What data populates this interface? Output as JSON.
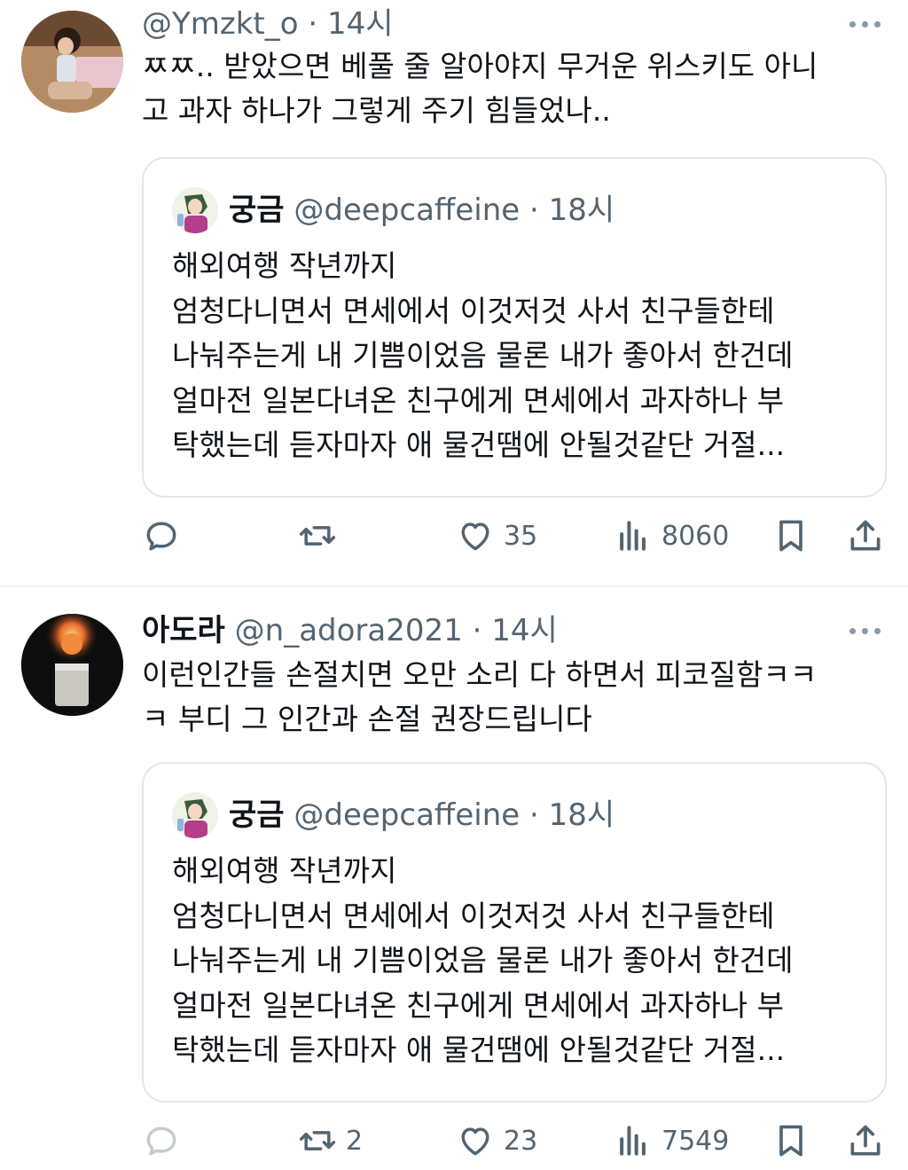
{
  "tweets": [
    {
      "name": "",
      "handle": "@Ymzkt_o",
      "dot": "·",
      "time": "14시",
      "text": "ㅉㅉ.. 받았으면 베풀 줄 알아야지 무거운 위스키도 아니\n고 과자 하나가 그렇게 주기 힘들었나..",
      "quote": {
        "name": "궁금",
        "handle": "@deepcaffeine",
        "dot": "·",
        "time": "18시",
        "text": "해외여행 작년까지\n엄청다니면서 면세에서 이것저것 사서 친구들한테\n나눠주는게 내 기쁨이었음 물론 내가 좋아서 한건데\n얼마전 일본다녀온 친구에게 면세에서 과자하나 부\n탁했는데 듣자마자 애 물건땜에 안될것같단 거절..."
      },
      "actions": {
        "reply": "",
        "retweet": "",
        "like": "35",
        "views": "8060"
      }
    },
    {
      "name": "아도라",
      "handle": "@n_adora2021",
      "dot": "·",
      "time": "14시",
      "text": "이런인간들 손절치면 오만 소리 다 하면서 피코질함ㅋㅋ\nㅋ 부디 그 인간과 손절 권장드립니다",
      "quote": {
        "name": "궁금",
        "handle": "@deepcaffeine",
        "dot": "·",
        "time": "18시",
        "text": "해외여행 작년까지\n엄청다니면서 면세에서 이것저것 사서 친구들한테\n나눠주는게 내 기쁨이었음 물론 내가 좋아서 한건데\n얼마전 일본다녀온 친구에게 면세에서 과자하나 부\n탁했는데 듣자마자 애 물건땜에 안될것같단 거절..."
      },
      "actions": {
        "reply": "",
        "retweet": "2",
        "like": "23",
        "views": "7549"
      }
    }
  ],
  "icons": {
    "reply": "reply-icon",
    "retweet": "retweet-icon",
    "like": "heart-icon",
    "views": "views-icon",
    "bookmark": "bookmark-icon",
    "share": "share-icon",
    "more": "more-icon"
  },
  "colors": {
    "text": "#0f1419",
    "muted": "#536471",
    "border": "#e1e6ea"
  }
}
